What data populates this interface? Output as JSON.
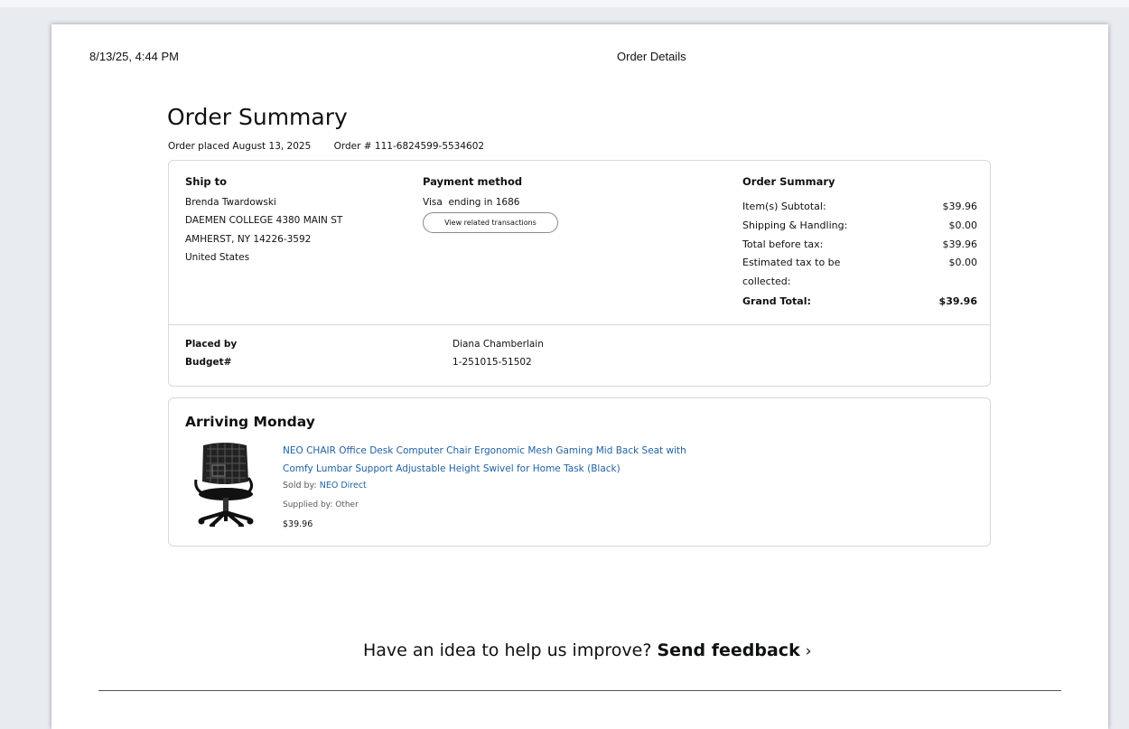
{
  "header": {
    "date": "8/13/25, 4:44 PM",
    "title": "Order Details"
  },
  "summary": {
    "title": "Order Summary",
    "placed": "Order placed August 13, 2025",
    "order_number": "Order # 111-6824599-5534602"
  },
  "ship_to": {
    "label": "Ship to",
    "lines": [
      "Brenda Twardowski",
      "DAEMEN COLLEGE 4380 MAIN ST",
      "AMHERST, NY 14226-3592",
      "United States"
    ]
  },
  "payment": {
    "label": "Payment method",
    "card": "Visa  ending in 1686",
    "button": "View related transactions"
  },
  "order_summary": {
    "label": "Order Summary",
    "rows": [
      {
        "label": "Item(s) Subtotal:",
        "value": "$39.96"
      },
      {
        "label": "Shipping & Handling:",
        "value": "$0.00"
      },
      {
        "label": "Total before tax:",
        "value": "$39.96"
      },
      {
        "label": "Estimated tax to be",
        "label2": "collected:",
        "value": "$0.00"
      },
      {
        "label": "Grand Total:",
        "value": "$39.96"
      }
    ]
  },
  "placed_by": {
    "label": "Placed by",
    "value": "Diana Chamberlain"
  },
  "budget": {
    "label": "Budget#",
    "value": "1-251015-51502"
  },
  "shipment": {
    "heading": "Arriving Monday",
    "item": {
      "image_icon": "office-chair-image",
      "title_line1": "NEO CHAIR Office Desk Computer Chair Ergonomic Mesh Gaming Mid Back Seat with",
      "title_line2": "Comfy Lumbar Support Adjustable Height Swivel for Home Task (Black)",
      "sold_by_label": "Sold by: ",
      "sold_by": "NEO Direct",
      "supplied_by": "Supplied by: Other",
      "price": "$39.96"
    }
  },
  "feedback": {
    "prompt": "Have an idea to help us improve?",
    "link": "Send feedback",
    "chevron": "›"
  },
  "colors": {
    "link": "#2162a1",
    "border": "#d5d9d9",
    "text": "#0f1111",
    "backdrop": "#e8ebf0"
  }
}
